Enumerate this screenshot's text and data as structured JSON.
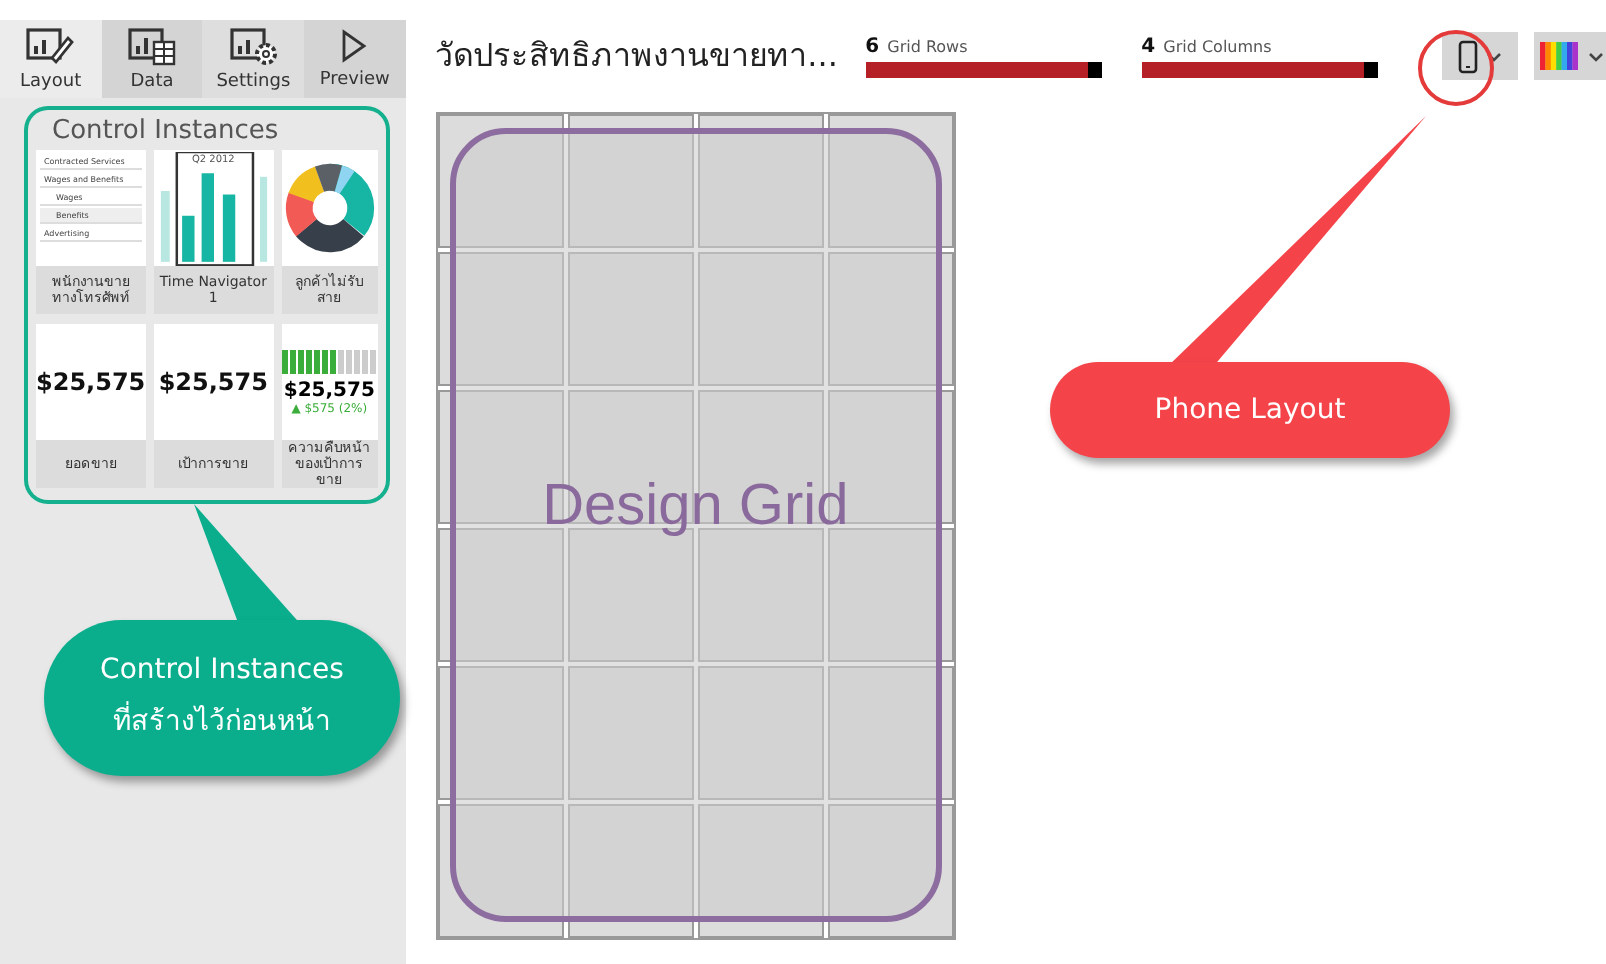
{
  "toolbar_tabs": [
    {
      "label": "Layout",
      "kind": "layout",
      "selected": true
    },
    {
      "label": "Data",
      "kind": "data",
      "selected": false
    },
    {
      "label": "Settings",
      "kind": "settings",
      "selected": false
    },
    {
      "label": "Preview",
      "kind": "preview",
      "selected": false
    }
  ],
  "panel": {
    "title": "Control Instances",
    "tiles": [
      {
        "kind": "slicer",
        "caption": "พนักงานขายทางโทรศัพท์",
        "items": [
          "Contracted Services",
          "Wages and Benefits",
          "Wages",
          "Benefits",
          "Advertising"
        ]
      },
      {
        "kind": "time-navigator",
        "caption": "Time Navigator 1",
        "chart_label": "Q2 2012"
      },
      {
        "kind": "donut",
        "caption": "ลูกค้าไม่รับสาย"
      },
      {
        "kind": "card",
        "caption": "ยอดขาย",
        "value": "$25,575"
      },
      {
        "kind": "card",
        "caption": "เป้าการขาย",
        "value": "$25,575"
      },
      {
        "kind": "gauge",
        "caption": "ความคืบหน้าของเป้าการขาย",
        "value": "$25,575",
        "delta": "▲ $575 (2%)"
      }
    ]
  },
  "header": {
    "title": "วัดประสิทธิภาพงานขายทา...",
    "sliders": [
      {
        "count": "6",
        "label": "Grid Rows",
        "level": 0.94
      },
      {
        "count": "4",
        "label": "Grid Columns",
        "level": 0.94
      }
    ],
    "layout_buttons": [
      {
        "kind": "phone",
        "highlighted": true
      },
      {
        "kind": "palette",
        "highlighted": false
      }
    ]
  },
  "canvas": {
    "label": "Design Grid"
  },
  "callouts": [
    {
      "kind": "instances",
      "lines": [
        "Control Instances",
        "ที่สร้างไว้ก่อนหน้า"
      ]
    },
    {
      "kind": "phone",
      "lines": [
        "Phone Layout"
      ]
    }
  ]
}
